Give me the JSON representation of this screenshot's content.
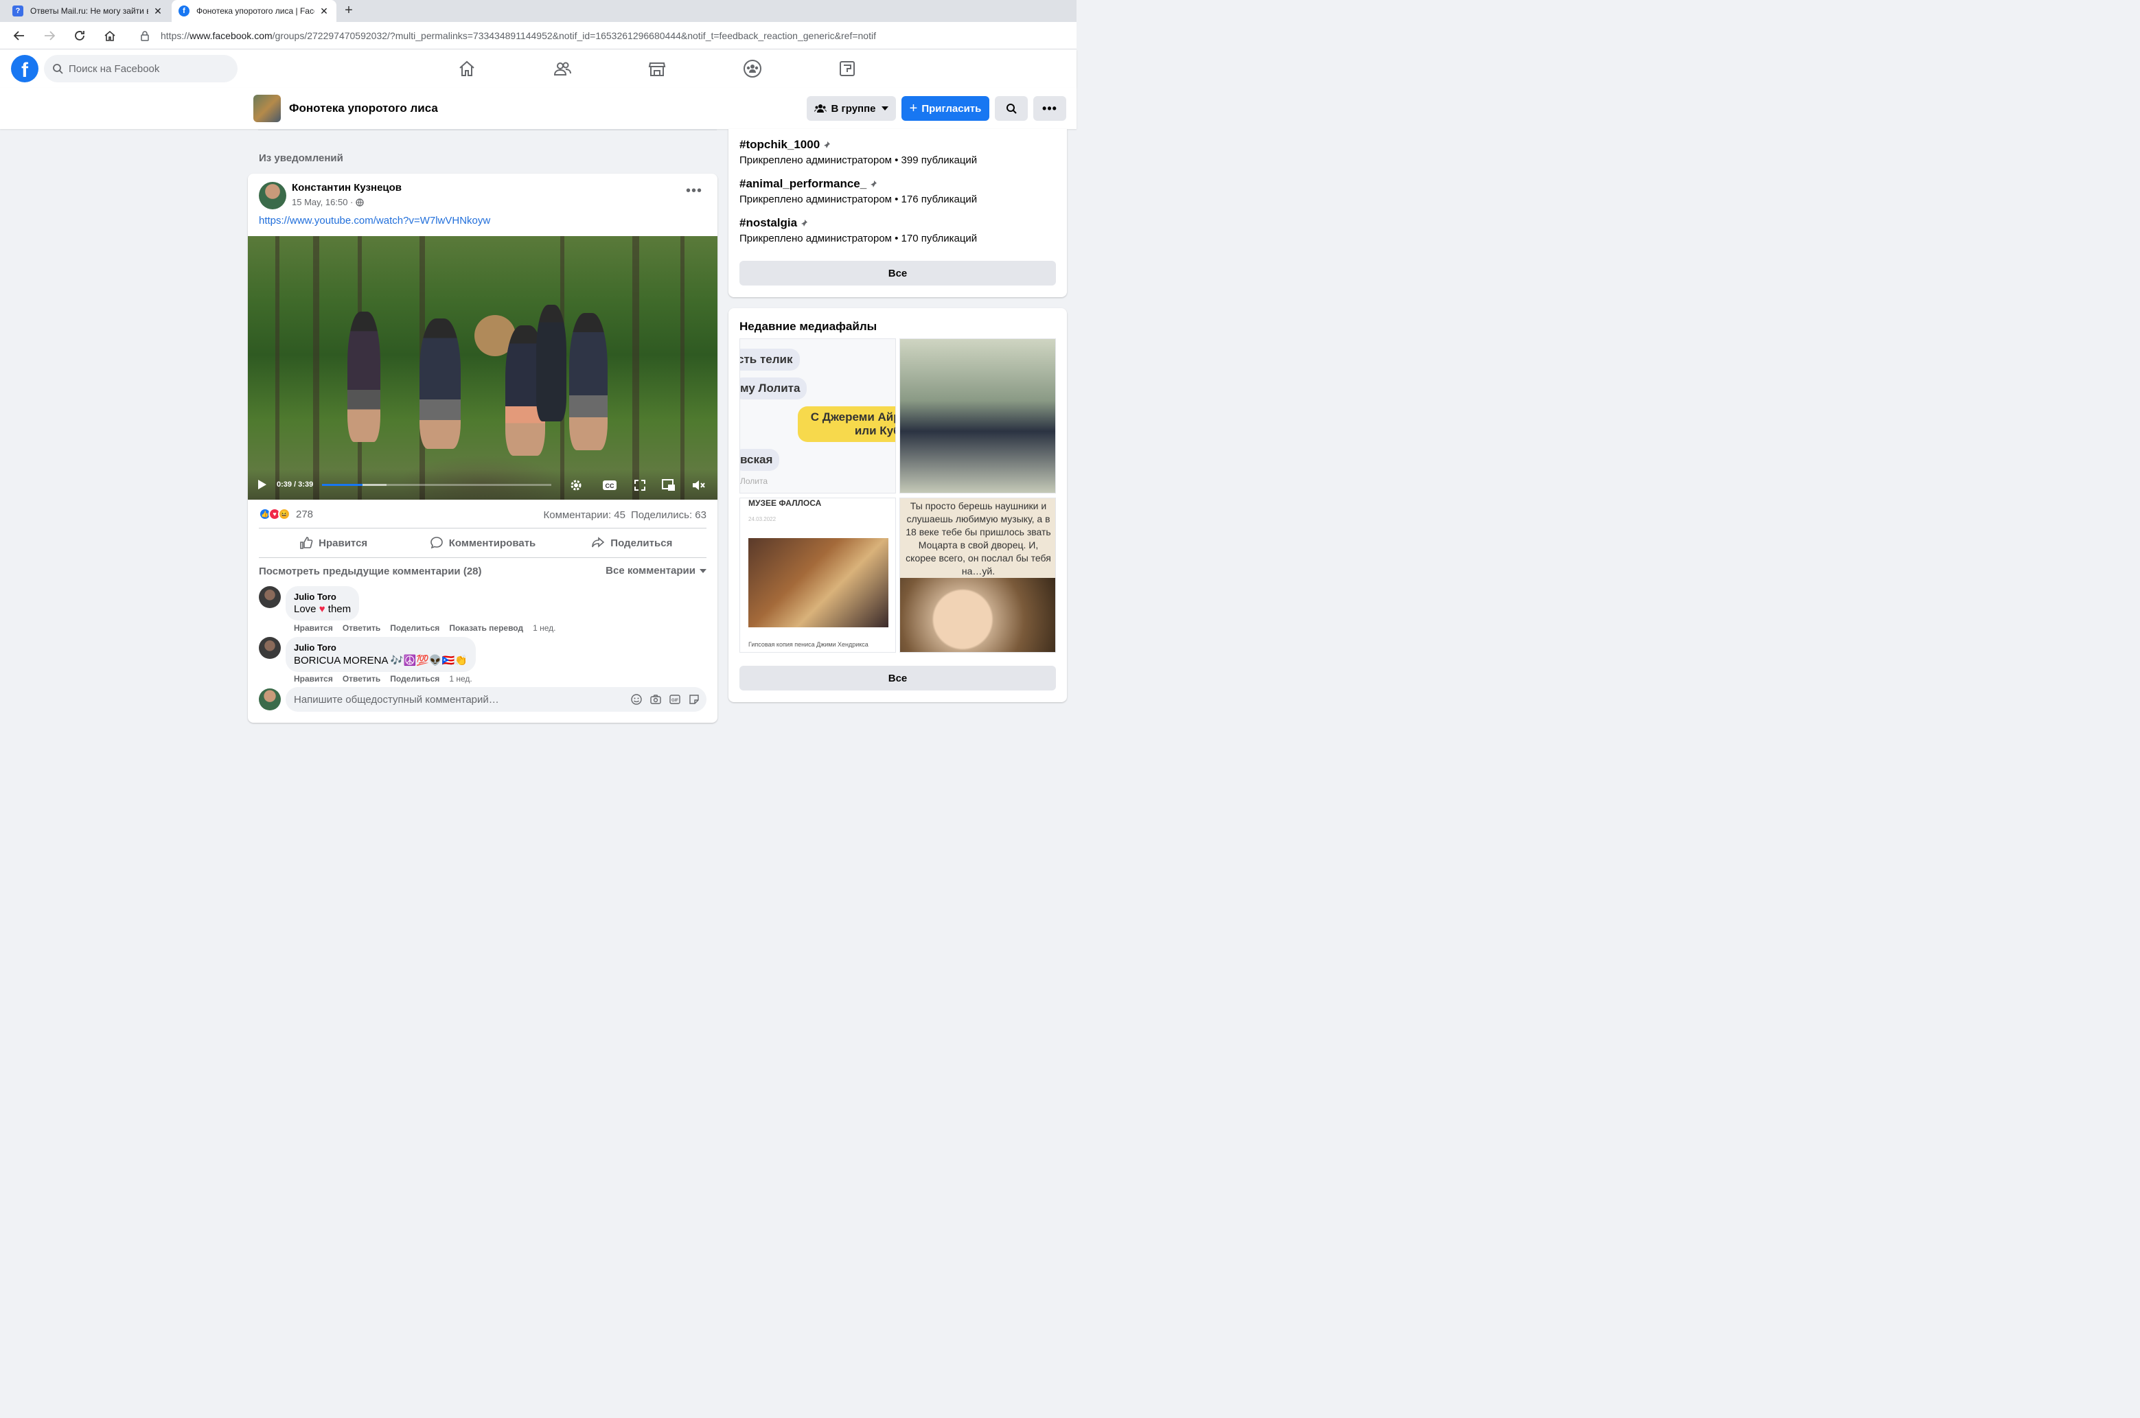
{
  "browser": {
    "tabs": [
      {
        "title": "Ответы Mail.ru: Не могу зайти в",
        "favicon": "mailru-answers-icon",
        "active": false
      },
      {
        "title": "Фонотека упоротого лиса | Face",
        "favicon": "facebook-icon",
        "active": true
      }
    ],
    "url_prefix": "https://",
    "url_host": "www.facebook.com",
    "url_path": "/groups/272297470592032/?multi_permalinks=733434891144952&notif_id=1653261296680444&notif_t=feedback_reaction_generic&ref=notif"
  },
  "fbnav": {
    "logo": "f",
    "search_placeholder": "Поиск на Facebook",
    "icons": [
      "home-icon",
      "friends-icon",
      "marketplace-icon",
      "groups-icon",
      "gaming-icon"
    ]
  },
  "group": {
    "name": "Фонотека упоротого лиса",
    "ingroup_label": "В группе",
    "invite_label": "Пригласить"
  },
  "feed": {
    "from_notifications": "Из уведомлений"
  },
  "post": {
    "author": "Константин Кузнецов",
    "date": "15 May, 16:50 ·",
    "link": "https://www.youtube.com/watch?v=W7lwVHNkoyw",
    "video": {
      "time": "0:39 / 3:39",
      "progress": 0.177,
      "buffered": 0.28
    },
    "reactions_count": "278",
    "comments_count": "Комментарии: 45",
    "shares_count": "Поделились: 63",
    "actions": {
      "like": "Нравится",
      "comment": "Комментировать",
      "share": "Поделиться"
    },
    "prev_comments": "Посмотреть предыдущие комментарии (28)",
    "all_comments": "Все комментарии",
    "comments": [
      {
        "name": "Julio Toro",
        "text_before": "Love ",
        "text_after": " them",
        "actions": [
          "Нравится",
          "Ответить",
          "Поделиться",
          "Показать перевод"
        ],
        "time": "1 нед."
      },
      {
        "name": "Julio Toro",
        "text": "BORICUA MORENA 🎶☮️💯👽🇵🇷👏",
        "actions": [
          "Нравится",
          "Ответить",
          "Поделиться"
        ],
        "time": "1 нед."
      }
    ],
    "composer_placeholder": "Напишите общедоступный комментарий…"
  },
  "sidebar": {
    "topics": [
      {
        "tag": "#topchik_1000",
        "meta": "Прикреплено администратором • 399 публикаций"
      },
      {
        "tag": "#animal_performance_",
        "meta": "Прикреплено администратором • 176 публикаций"
      },
      {
        "tag": "#nostalgia",
        "meta": "Прикреплено администратором • 170 публикаций"
      }
    ],
    "all_label": "Все",
    "media_title": "Недавние медиафайлы",
    "media1": {
      "b1": "сть телик",
      "b2": "му Лолита",
      "b3_line1": "С Джереми Айро",
      "b3_line2": "или Кубр",
      "b4": "вская",
      "sub": "Лолита"
    },
    "media3": {
      "title": "МУЗЕЕ ФАЛЛОСА",
      "date": "24.03.2022",
      "caption": "Гипсовая копия пениса Джими Хендрикса"
    },
    "media4": {
      "text": "Ты просто берешь наушники и слушаешь любимую музыку, а в 18 веке тебе бы пришлось звать Моцарта в свой дворец. И, скорее всего, он послал бы тебя на…уй."
    },
    "media_all_label": "Все"
  },
  "colors": {
    "brand": "#1877f2",
    "link": "#216fdb",
    "page_bg": "#f0f2f5"
  }
}
